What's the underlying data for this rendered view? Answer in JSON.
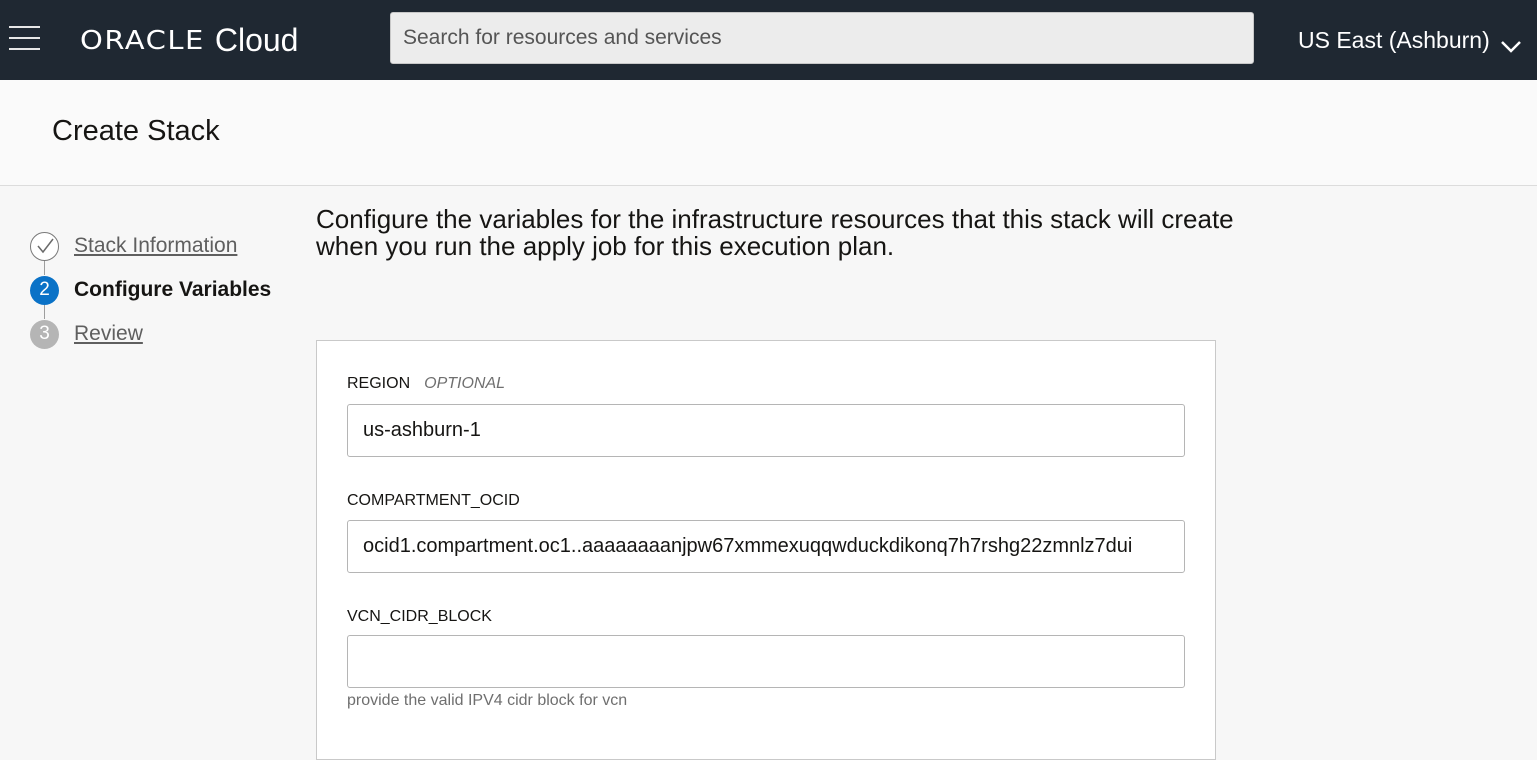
{
  "header": {
    "logo_brand": "ORACLE",
    "logo_product": "Cloud",
    "search_placeholder": "Search for resources and services",
    "region_label": "US East (Ashburn)",
    "menu_icon": "hamburger-menu-icon",
    "region_icon": "chevron-down-icon",
    "background_color": "#1f2832"
  },
  "page": {
    "title": "Create Stack"
  },
  "steps": [
    {
      "number": "1",
      "label": "Stack Information",
      "state": "complete",
      "icon": "check-circle-icon"
    },
    {
      "number": "2",
      "label": "Configure Variables",
      "state": "current"
    },
    {
      "number": "3",
      "label": "Review",
      "state": "upcoming"
    }
  ],
  "main": {
    "intro": "Configure the variables for the infrastructure resources that this stack will create when you run the apply job for this execution plan.",
    "fields": [
      {
        "label": "REGION",
        "optional_label": "OPTIONAL",
        "value": "us-ashburn-1",
        "help": ""
      },
      {
        "label": "COMPARTMENT_OCID",
        "optional_label": "",
        "value": "ocid1.compartment.oc1..aaaaaaaanjpw67xmmexuqqwduckdikonq7h7rshg22zmnlz7dui",
        "help": ""
      },
      {
        "label": "VCN_CIDR_BLOCK",
        "optional_label": "",
        "value": "",
        "help": "provide the valid IPV4 cidr block for vcn"
      }
    ]
  },
  "colors": {
    "accent": "#0a72c7",
    "step_upcoming": "#b5b5b5"
  }
}
